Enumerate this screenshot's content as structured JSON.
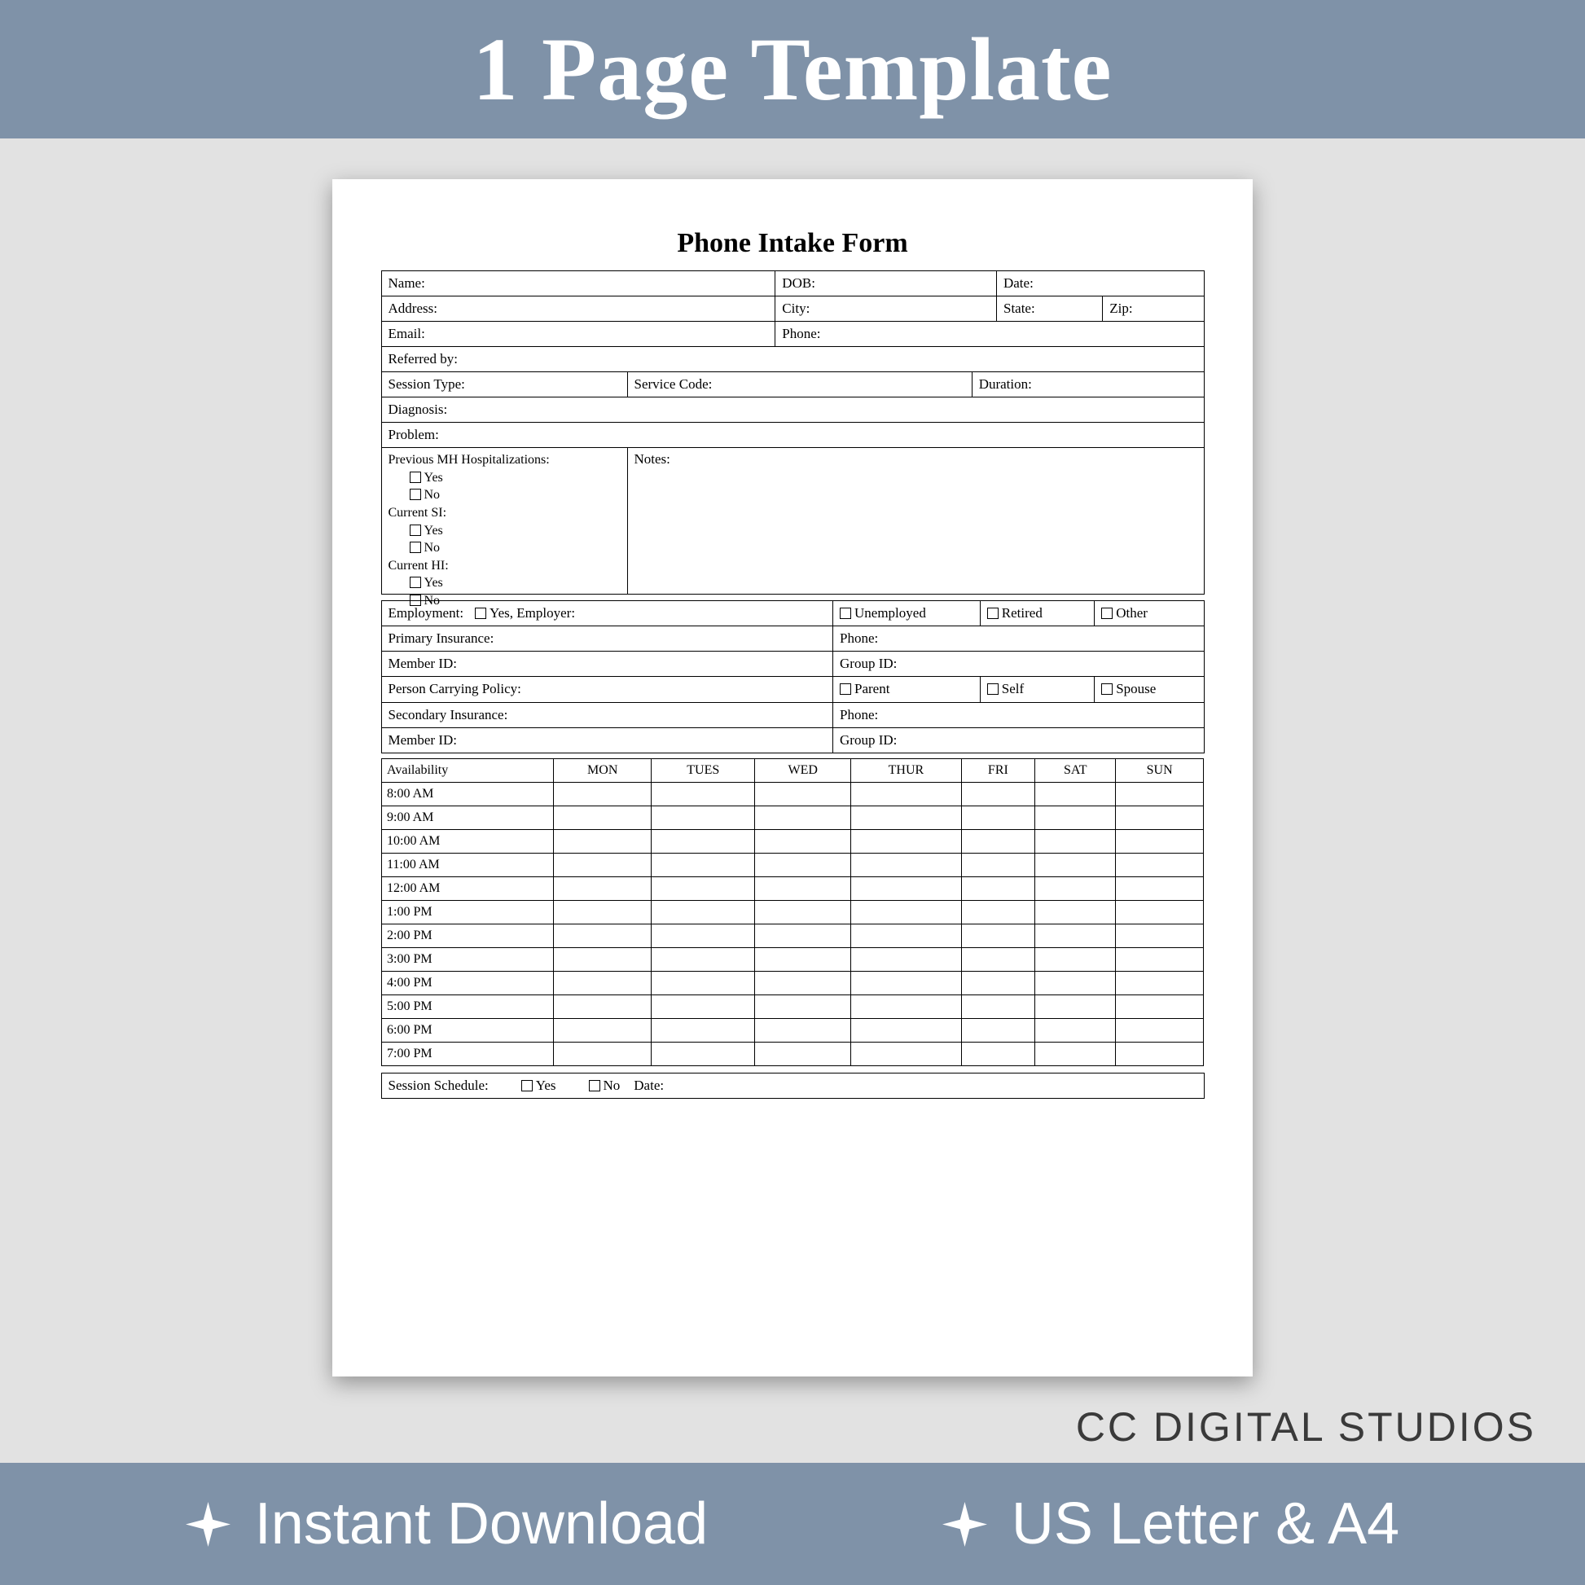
{
  "banner": {
    "title": "1 Page Template"
  },
  "brand": "CC DIGITAL STUDIOS",
  "features": [
    "Instant Download",
    "US Letter & A4"
  ],
  "form": {
    "title": "Phone Intake Form",
    "r1": {
      "name": "Name:",
      "dob": "DOB:",
      "date": "Date:"
    },
    "r2": {
      "address": "Address:",
      "city": "City:",
      "state": "State:",
      "zip": "Zip:"
    },
    "r3": {
      "email": "Email:",
      "phone": "Phone:"
    },
    "r4": {
      "referred": "Referred by:"
    },
    "r5": {
      "session_type": "Session Type:",
      "service_code": "Service Code:",
      "duration": "Duration:"
    },
    "r6": {
      "diagnosis": "Diagnosis:"
    },
    "r7": {
      "problem": "Problem:"
    },
    "mh": {
      "prev": "Previous MH Hospitalizations:",
      "yes": "Yes",
      "no": "No",
      "si": "Current SI:",
      "hi": "Current HI:",
      "notes": "Notes:"
    },
    "emp": {
      "employment": "Employment:",
      "yes_employer": "Yes, Employer:",
      "unemployed": "Unemployed",
      "retired": "Retired",
      "other": "Other"
    },
    "ins": {
      "primary": "Primary Insurance:",
      "phone": "Phone:",
      "member_id": "Member ID:",
      "group_id": "Group ID:",
      "carrying": "Person Carrying Policy:",
      "parent": "Parent",
      "self": "Self",
      "spouse": "Spouse",
      "secondary": "Secondary Insurance:"
    },
    "avail": {
      "header": "Availability",
      "days": [
        "MON",
        "TUES",
        "WED",
        "THUR",
        "FRI",
        "SAT",
        "SUN"
      ],
      "times": [
        "8:00 AM",
        "9:00 AM",
        "10:00 AM",
        "11:00 AM",
        "12:00 AM",
        "1:00 PM",
        "2:00 PM",
        "3:00 PM",
        "4:00 PM",
        "5:00 PM",
        "6:00 PM",
        "7:00 PM"
      ]
    },
    "sched": {
      "label": "Session Schedule:",
      "yes": "Yes",
      "no": "No",
      "date": "Date:"
    }
  }
}
